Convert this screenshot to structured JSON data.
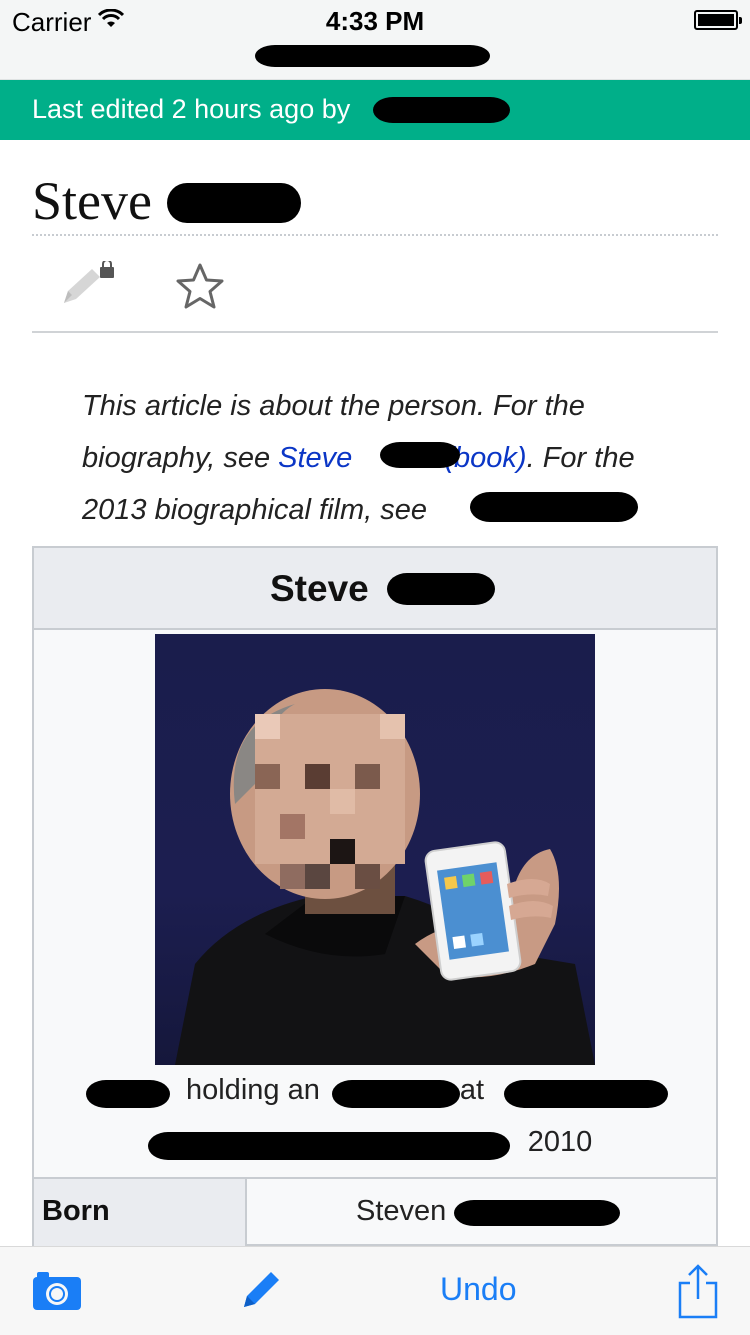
{
  "status_bar": {
    "carrier": "Carrier",
    "time": "4:33 PM"
  },
  "banner": {
    "text": "Last edited 2 hours ago by"
  },
  "article": {
    "title": "Steve",
    "hatnote": {
      "part1": "This article is about the person. For the biography, see ",
      "link1": "Steve",
      "link1_suffix": " (book)",
      "part2": ". For the 2013 biographical film, see"
    }
  },
  "infobox": {
    "header": "Steve",
    "caption_line1_a": "holding an",
    "caption_line1_b": "at",
    "caption_line2": "2010",
    "born_label": "Born",
    "born_value": "Steven"
  },
  "toolbar": {
    "undo_label": "Undo"
  },
  "icons": {
    "wifi": "wifi-icon",
    "battery": "battery-icon",
    "edit_locked": "pencil-lock-icon",
    "watch": "star-icon",
    "camera": "camera-icon",
    "edit": "pencil-icon",
    "share": "share-icon"
  },
  "colors": {
    "banner": "#00af89",
    "link": "#0b36c6",
    "toolbar_accent": "#1a7ef6"
  }
}
